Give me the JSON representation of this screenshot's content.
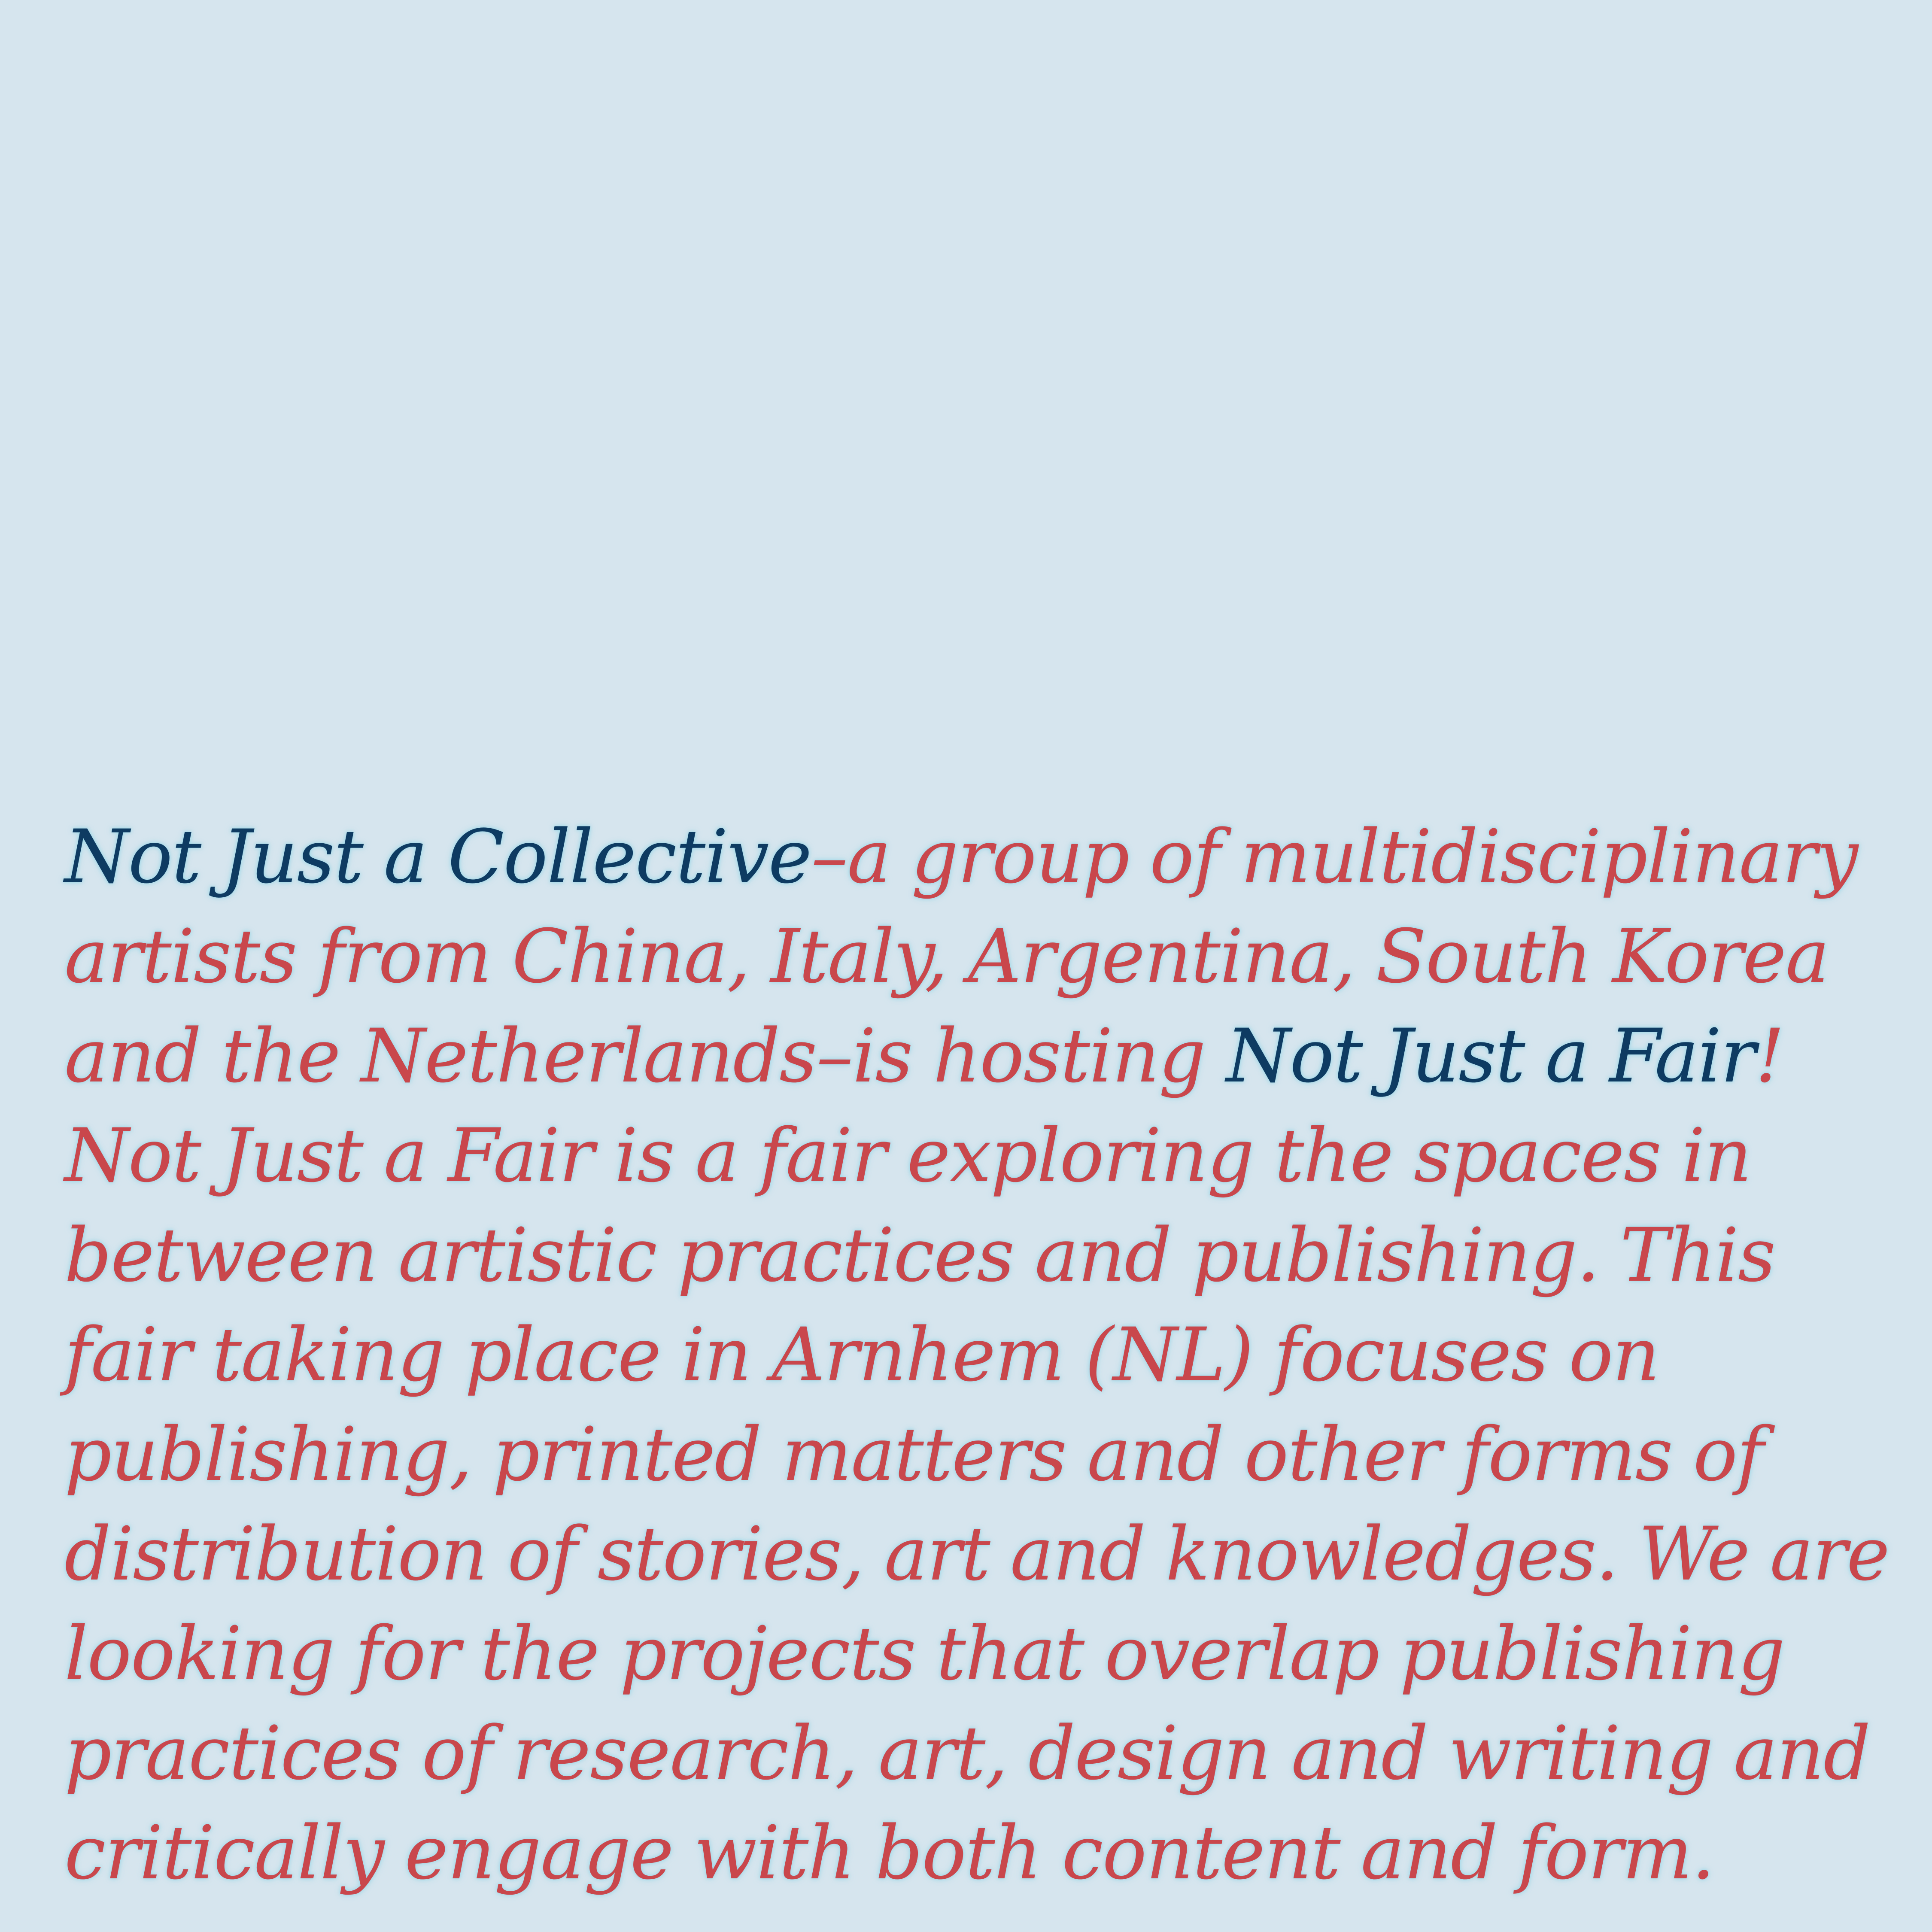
{
  "colors": {
    "background": "#d6e5ee",
    "body_text": "#c9474c",
    "accent_text": "#0e3b62",
    "glow": "#96d7e8"
  },
  "statement": {
    "collective_name": "Not Just a Collective",
    "line_1_rest": "–a group of multidisciplinary",
    "line_2": "artists from China, Italy, Argentina, South Korea",
    "line_3_start": "and the Netherlands–is hosting ",
    "fair_name": "Not Just a Fair",
    "line_3_end": "!",
    "line_4": "Not Just a Fair is a fair exploring the spaces in",
    "line_5": "between artistic practices and publishing. This",
    "line_6": "fair taking place in Arnhem (NL) focuses on",
    "line_7": "publishing, printed matters and other forms of",
    "line_8": "distribution of stories, art and knowledges. We are",
    "line_9": "looking for the projects that overlap publishing",
    "line_10": "practices of research, art, design and writing and",
    "line_11": "critically engage with both content and form."
  }
}
